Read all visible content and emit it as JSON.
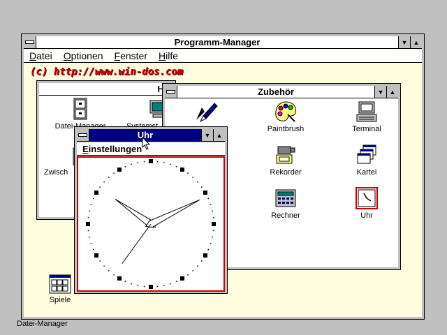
{
  "program_manager": {
    "title": "Programm-Manager",
    "menu": [
      "Datei",
      "Optionen",
      "Fenster",
      "Hilfe"
    ],
    "watermark": "(c) http://www.win-dos.com",
    "spiele_label": "Spiele"
  },
  "haupt_window": {
    "title_partial": "Ha",
    "icons": [
      "Datei-Manager",
      "Systemst",
      "Zwisch"
    ]
  },
  "zubehoer_window": {
    "title": "Zubehör",
    "icons": [
      "Paintbrush",
      "Terminal",
      "Rekorder",
      "Kartei",
      "Rechner",
      "Uhr"
    ]
  },
  "uhr_window": {
    "title": "Uhr",
    "menu": [
      "Einstellungen"
    ]
  },
  "clock": {
    "hour": 10,
    "minute": 10,
    "second": 36
  },
  "status": "Datei-Manager",
  "colors": {
    "desktop": "#c0c0c0",
    "active_title": "#000080",
    "pm_background": "#fffde0",
    "watermark": "#d00000",
    "clock_border": "#cc0000"
  }
}
